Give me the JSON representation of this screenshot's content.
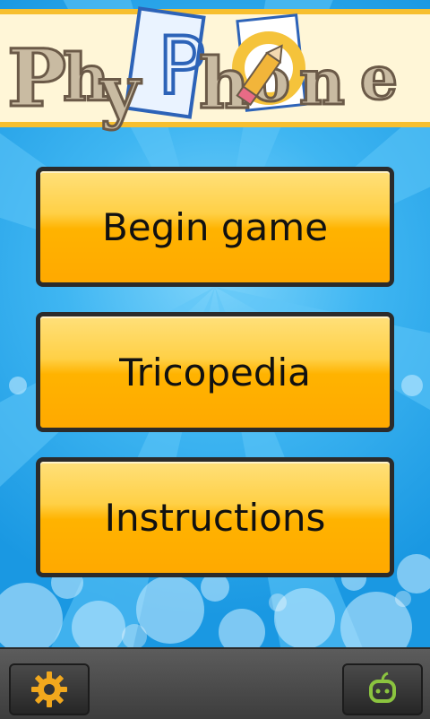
{
  "app": {
    "logo_text": "PhyPhone",
    "logo_letters": [
      "P",
      "h",
      "y",
      "P",
      "h",
      "o",
      "n",
      "e"
    ]
  },
  "menu": {
    "items": [
      {
        "label": "Begin game"
      },
      {
        "label": "Tricopedia"
      },
      {
        "label": "Instructions"
      }
    ]
  },
  "bottom_bar": {
    "left_icon": "gear-icon",
    "right_icon": "android-icon"
  },
  "colors": {
    "accent": "#f7bf2f",
    "button": "#ffb300",
    "background": "#2aa7ec",
    "gear": "#f2a81d",
    "android": "#8bc43f"
  }
}
